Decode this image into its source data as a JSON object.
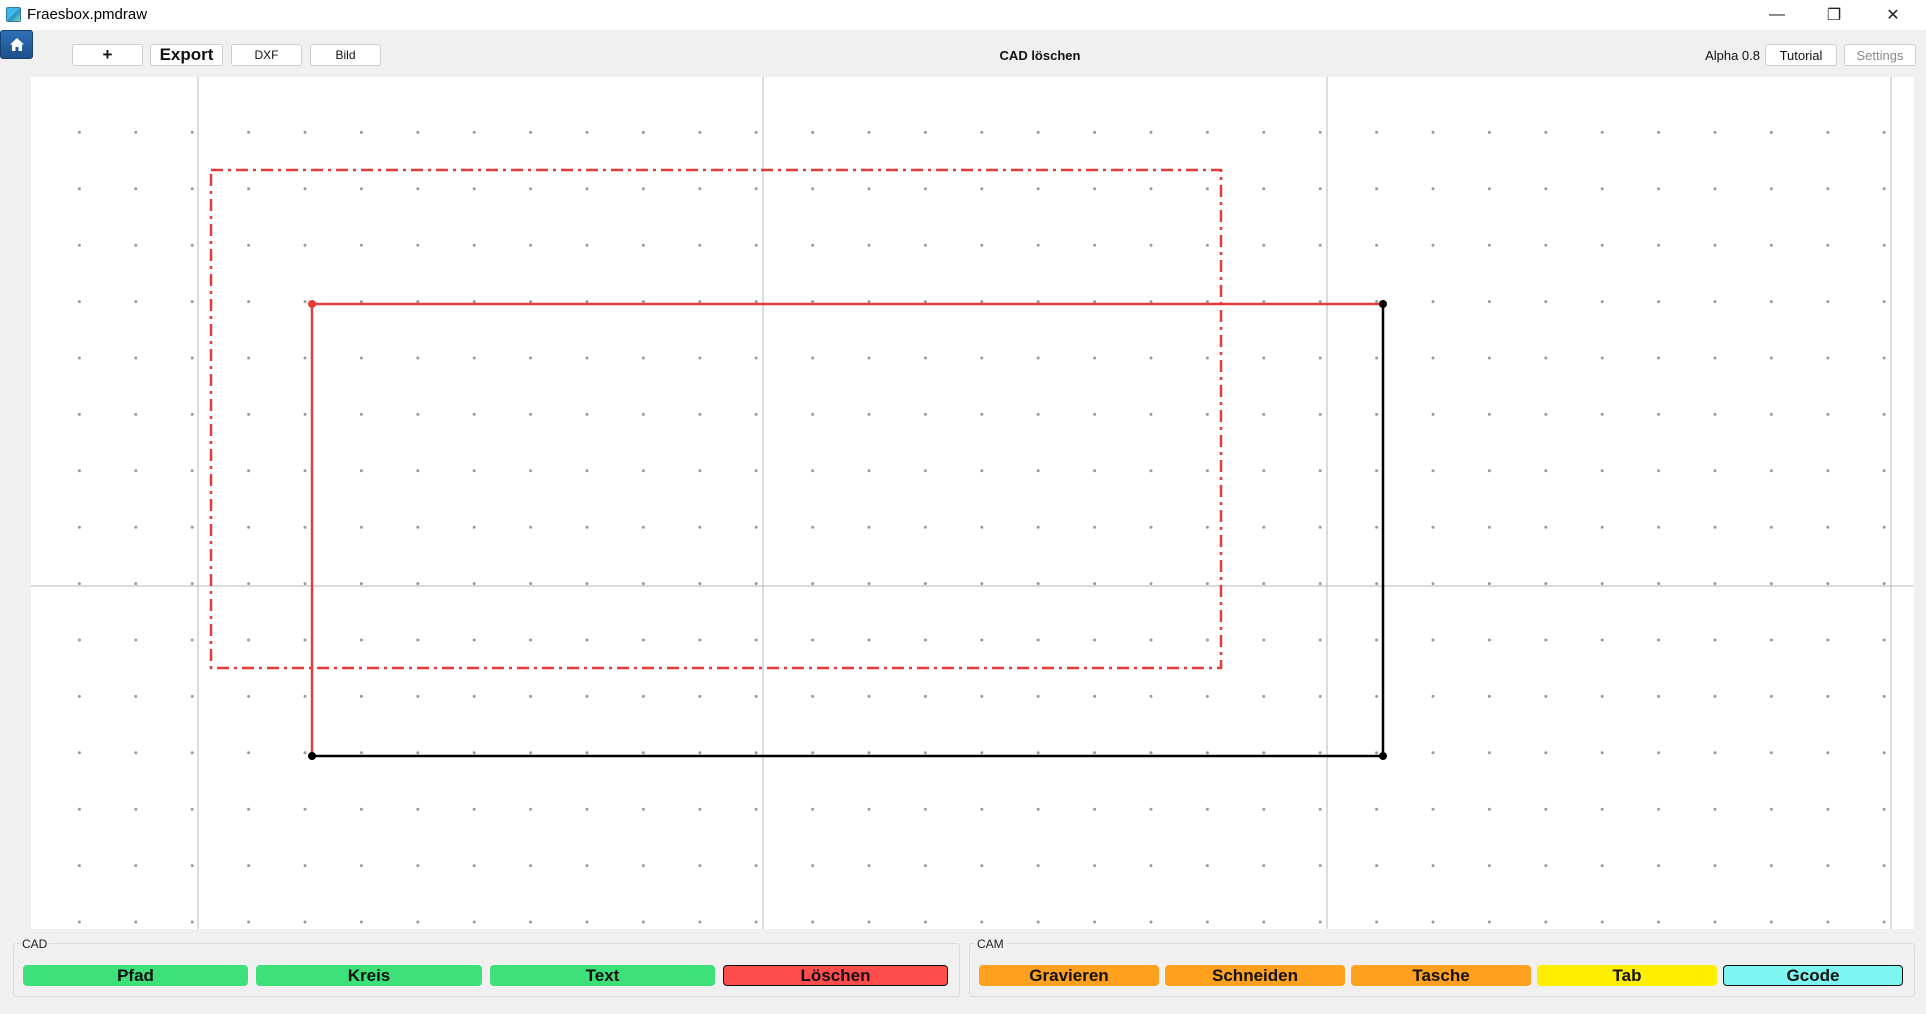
{
  "window": {
    "title": "Fraesbox.pmdraw",
    "minimize_glyph": "—",
    "maximize_glyph": "❐",
    "close_glyph": "✕"
  },
  "toolbar": {
    "add_label": "+",
    "export_label": "Export",
    "dxf_label": "DXF",
    "bild_label": "Bild",
    "mode_title": "CAD löschen",
    "version": "Alpha 0.8",
    "tutorial_label": "Tutorial",
    "settings_label": "Settings"
  },
  "panels": {
    "cad": {
      "title": "CAD",
      "buttons": [
        {
          "label": "Pfad",
          "color": "#3ee07a"
        },
        {
          "label": "Kreis",
          "color": "#3ee07a"
        },
        {
          "label": "Text",
          "color": "#3ee07a"
        },
        {
          "label": "Löschen",
          "color": "#ff4d4d"
        }
      ]
    },
    "cam": {
      "title": "CAM",
      "buttons": [
        {
          "label": "Gravieren",
          "color": "#ffa01e"
        },
        {
          "label": "Schneiden",
          "color": "#ffa01e"
        },
        {
          "label": "Tasche",
          "color": "#ffa01e"
        },
        {
          "label": "Tab",
          "color": "#ffee00"
        },
        {
          "label": "Gcode",
          "color": "#7df5f0"
        }
      ]
    }
  },
  "colors": {
    "selected": "#e83a3a",
    "shape": "#000000",
    "grid_line": "#b8b8b8",
    "grid_dot": "#9a9a9a"
  }
}
